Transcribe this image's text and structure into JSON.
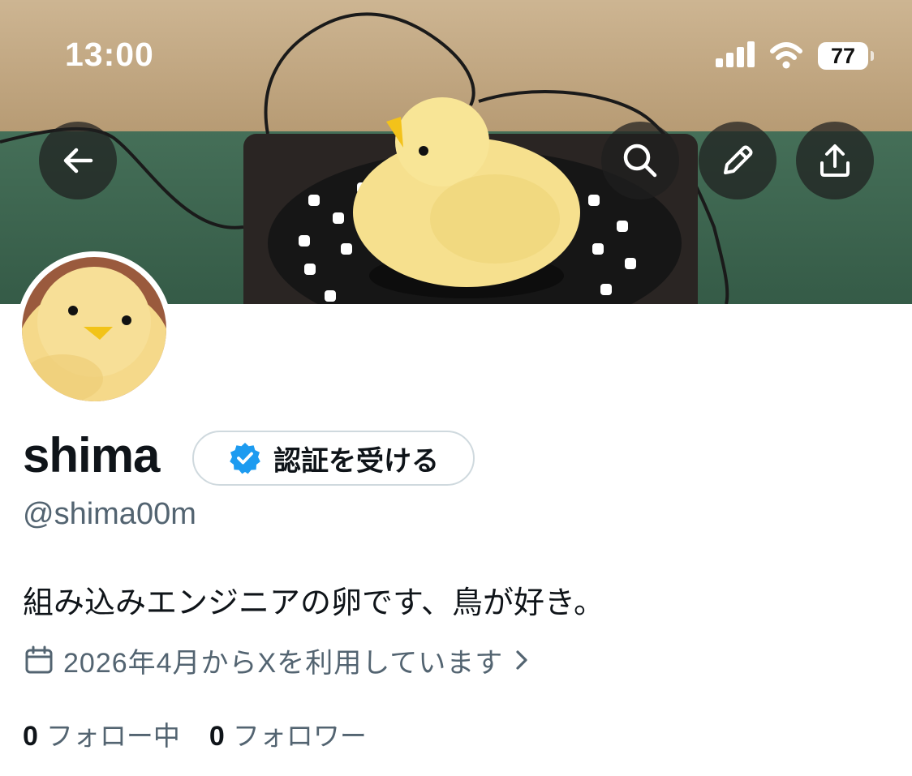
{
  "status_bar": {
    "time": "13:00",
    "battery": "77"
  },
  "banner_icons": [
    "back-arrow-icon",
    "search-icon",
    "pencil-icon",
    "share-icon"
  ],
  "profile": {
    "display_name": "shima",
    "verify_label": "認証を受ける",
    "handle": "@shima00m",
    "bio": "組み込みエンジニアの卵です、鳥が好き。",
    "joined": "2026年4月からXを利用しています",
    "following_count": "0",
    "following_label": "フォロー中",
    "followers_count": "0",
    "followers_label": "フォロワー"
  },
  "colors": {
    "verified_blue": "#1d9bf0",
    "secondary_text": "#536471",
    "primary_text": "#0f1419"
  }
}
